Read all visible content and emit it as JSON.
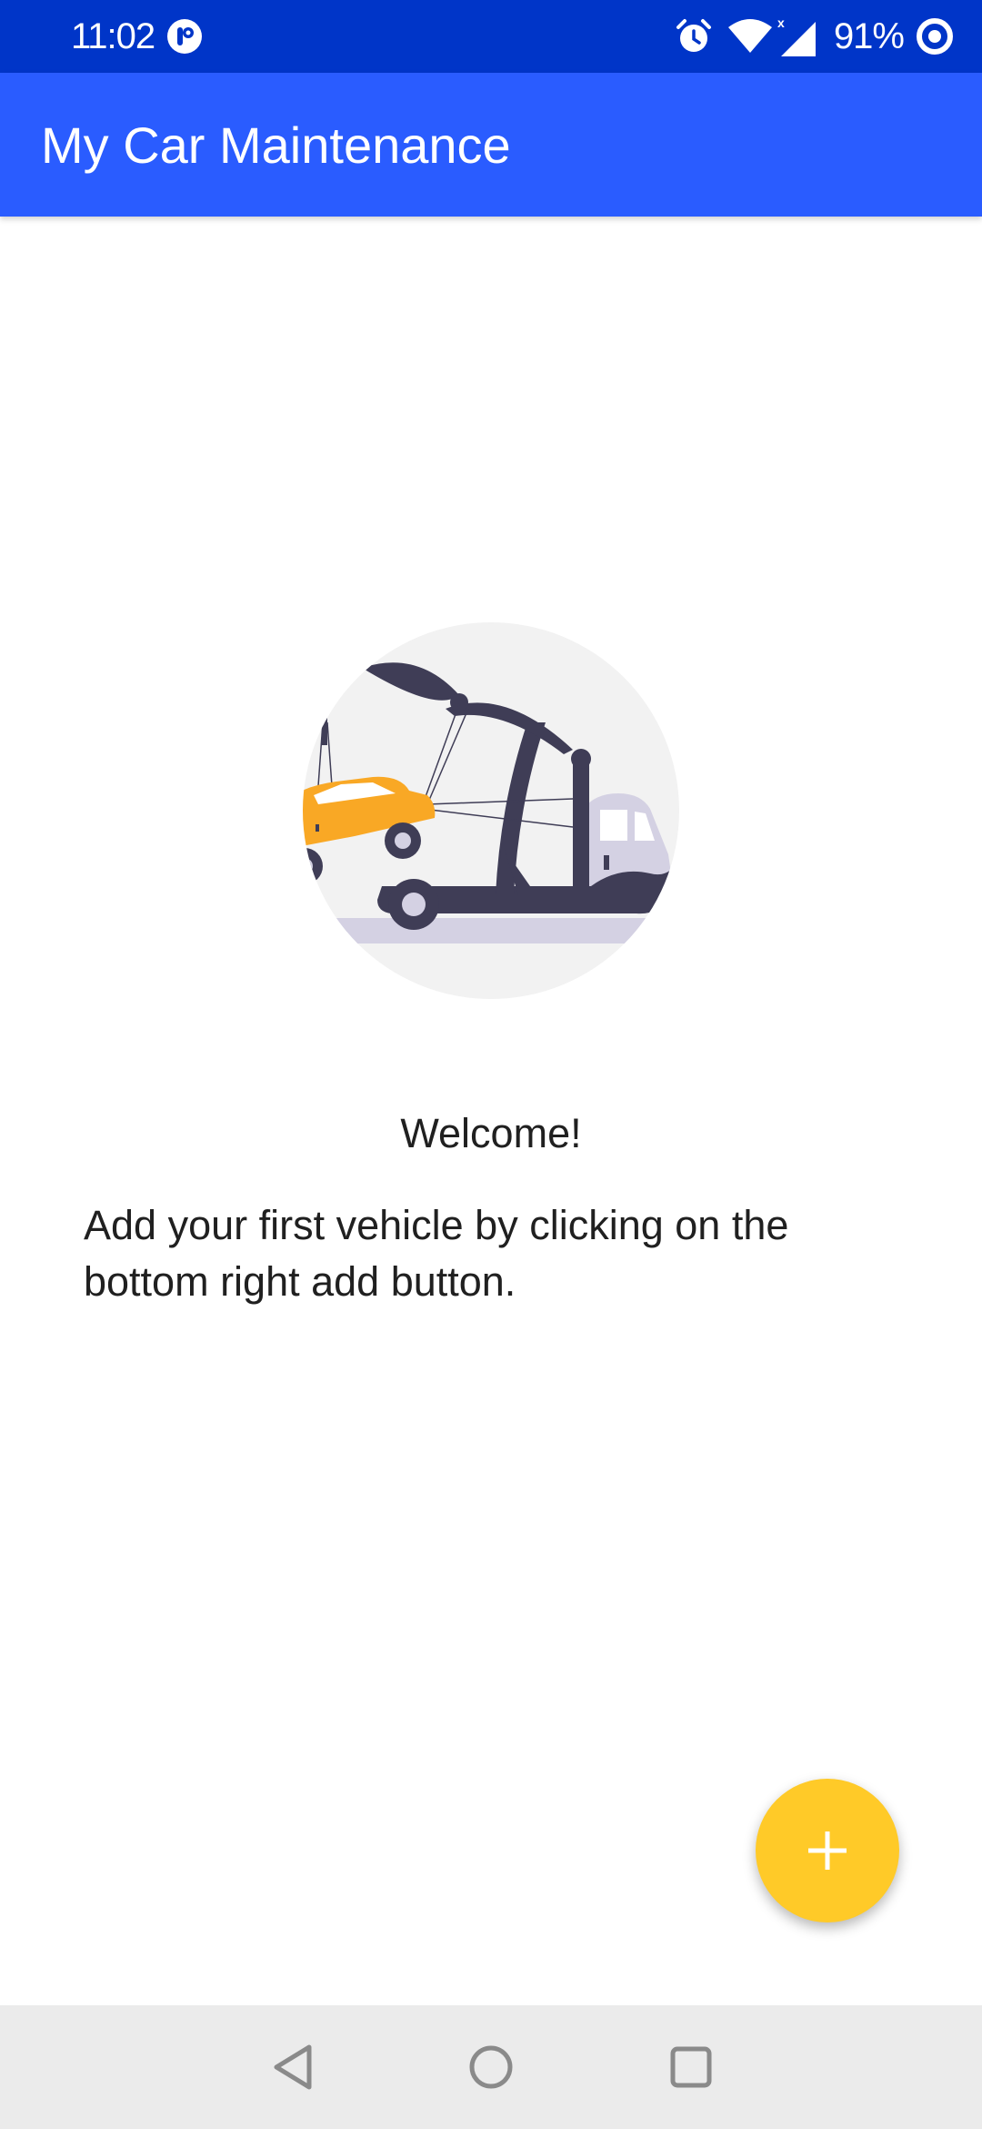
{
  "status_bar": {
    "time": "11:02",
    "battery": "91%",
    "background_color": "#0035c8",
    "icons": [
      "app-notification-icon",
      "alarm-icon",
      "wifi-icon",
      "signal-icon",
      "battery-ring-icon"
    ]
  },
  "app_bar": {
    "title": "My Car Maintenance",
    "background_color": "#2a5cff"
  },
  "empty_state": {
    "illustration": "tow-truck-illustration",
    "welcome": "Welcome!",
    "message": "Add your first vehicle by clicking on the bottom right add button."
  },
  "fab": {
    "icon": "plus-icon",
    "color": "#ffca28"
  },
  "nav_bar": {
    "buttons": [
      "back-icon",
      "home-icon",
      "recents-icon"
    ]
  }
}
